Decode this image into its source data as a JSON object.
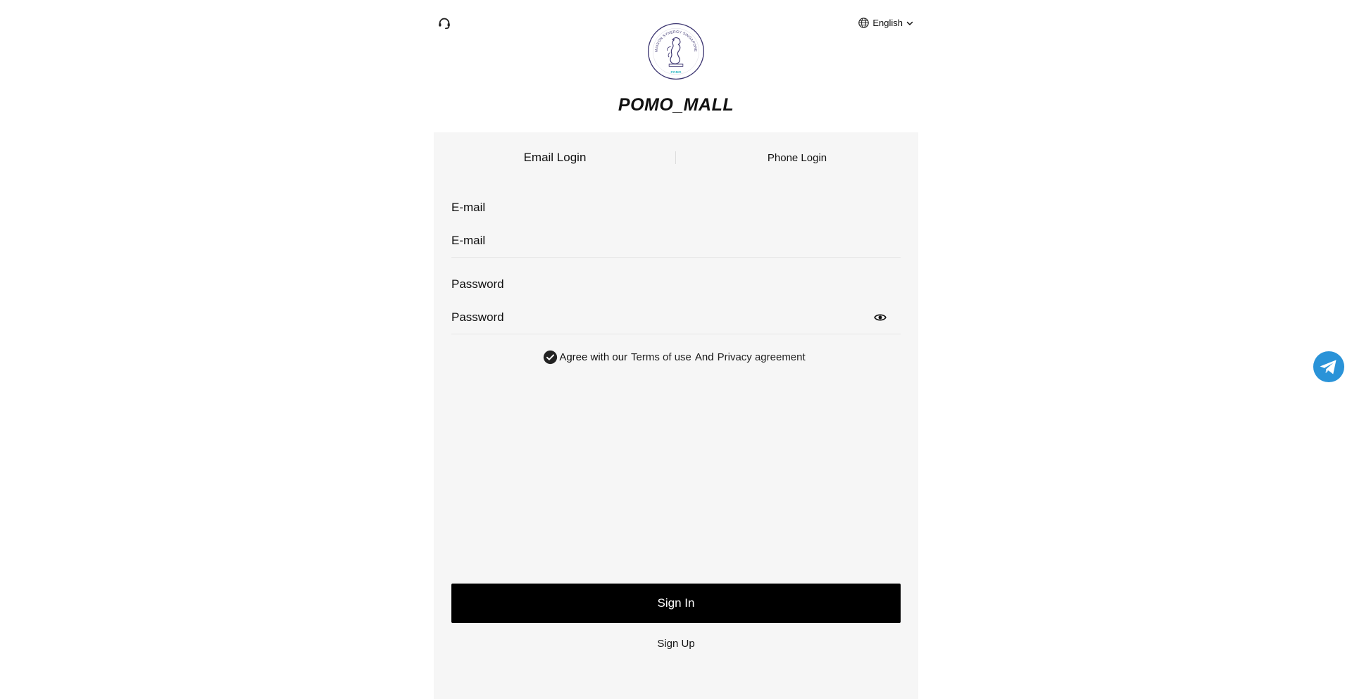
{
  "header": {
    "support_icon": "headset-icon",
    "language": {
      "label": "English",
      "icon": "globe-icon",
      "dropdown_icon": "chevron-down-icon"
    }
  },
  "brand": {
    "logo_ring_text": "MAISON SYNERGY SINGAPORE",
    "logo_small_text": "POMO",
    "name": "POMO_MALL"
  },
  "tabs": {
    "email_login": "Email Login",
    "phone_login": "Phone Login"
  },
  "form": {
    "email_label": "E-mail",
    "email_placeholder": "E-mail",
    "password_label": "Password",
    "password_placeholder": "Password",
    "eye_icon": "eye-icon"
  },
  "agreement": {
    "prefix": "Agree with our",
    "terms": "Terms of use",
    "and": "And",
    "privacy": "Privacy agreement",
    "checked": true
  },
  "actions": {
    "sign_in": "Sign In",
    "sign_up": "Sign Up"
  },
  "floating": {
    "telegram_icon": "telegram-icon"
  },
  "colors": {
    "card_bg": "#f6f6f6",
    "button_bg": "#000000",
    "logo_purple": "#3b3470",
    "logo_teal": "#2fb7c4",
    "telegram_blue": "#2a93d8"
  }
}
